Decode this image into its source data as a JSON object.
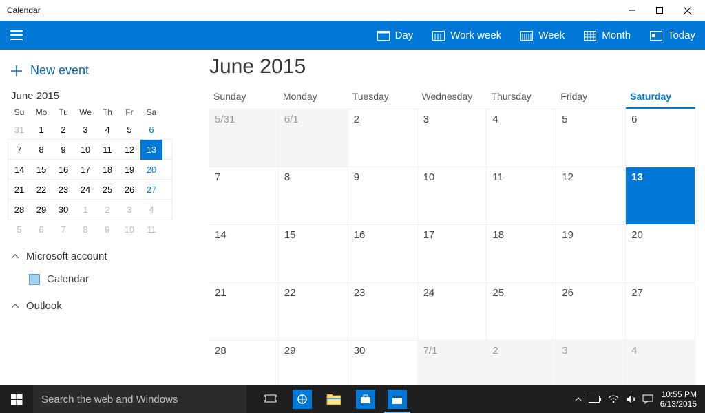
{
  "window": {
    "title": "Calendar"
  },
  "ribbon": {
    "views": {
      "day": "Day",
      "workweek": "Work week",
      "week": "Week",
      "month": "Month",
      "today": "Today"
    }
  },
  "sidebar": {
    "new_event": "New event",
    "mini": {
      "month_label": "June 2015",
      "dow": [
        "Su",
        "Mo",
        "Tu",
        "We",
        "Th",
        "Fr",
        "Sa"
      ],
      "rows": [
        [
          {
            "d": "31",
            "dim": true
          },
          {
            "d": "1"
          },
          {
            "d": "2"
          },
          {
            "d": "3"
          },
          {
            "d": "4"
          },
          {
            "d": "5"
          },
          {
            "d": "6",
            "sat": true
          }
        ],
        [
          {
            "d": "7"
          },
          {
            "d": "8"
          },
          {
            "d": "9"
          },
          {
            "d": "10"
          },
          {
            "d": "11"
          },
          {
            "d": "12"
          },
          {
            "d": "13",
            "sat": true,
            "today": true
          }
        ],
        [
          {
            "d": "14"
          },
          {
            "d": "15"
          },
          {
            "d": "16"
          },
          {
            "d": "17"
          },
          {
            "d": "18"
          },
          {
            "d": "19"
          },
          {
            "d": "20",
            "sat": true
          }
        ],
        [
          {
            "d": "21"
          },
          {
            "d": "22"
          },
          {
            "d": "23"
          },
          {
            "d": "24"
          },
          {
            "d": "25"
          },
          {
            "d": "26"
          },
          {
            "d": "27",
            "sat": true
          }
        ],
        [
          {
            "d": "28"
          },
          {
            "d": "29"
          },
          {
            "d": "30"
          },
          {
            "d": "1",
            "dim": true
          },
          {
            "d": "2",
            "dim": true
          },
          {
            "d": "3",
            "dim": true
          },
          {
            "d": "4",
            "dim": true
          }
        ],
        [
          {
            "d": "5",
            "dim": true
          },
          {
            "d": "6",
            "dim": true
          },
          {
            "d": "7",
            "dim": true
          },
          {
            "d": "8",
            "dim": true
          },
          {
            "d": "9",
            "dim": true
          },
          {
            "d": "10",
            "dim": true
          },
          {
            "d": "11",
            "dim": true
          }
        ]
      ]
    },
    "accounts": [
      {
        "name": "Microsoft account",
        "calendars": [
          {
            "name": "Calendar"
          }
        ]
      },
      {
        "name": "Outlook",
        "calendars": []
      }
    ]
  },
  "main": {
    "title": "June 2015",
    "dow": [
      "Sunday",
      "Monday",
      "Tuesday",
      "Wednesday",
      "Thursday",
      "Friday",
      "Saturday"
    ],
    "cells": [
      {
        "d": "5/31",
        "other": true
      },
      {
        "d": "6/1",
        "other": true
      },
      {
        "d": "2"
      },
      {
        "d": "3"
      },
      {
        "d": "4"
      },
      {
        "d": "5"
      },
      {
        "d": "6"
      },
      {
        "d": "7"
      },
      {
        "d": "8"
      },
      {
        "d": "9"
      },
      {
        "d": "10"
      },
      {
        "d": "11"
      },
      {
        "d": "12"
      },
      {
        "d": "13",
        "today": true
      },
      {
        "d": "14"
      },
      {
        "d": "15"
      },
      {
        "d": "16"
      },
      {
        "d": "17"
      },
      {
        "d": "18"
      },
      {
        "d": "19"
      },
      {
        "d": "20"
      },
      {
        "d": "21"
      },
      {
        "d": "22"
      },
      {
        "d": "23"
      },
      {
        "d": "24"
      },
      {
        "d": "25"
      },
      {
        "d": "26"
      },
      {
        "d": "27"
      },
      {
        "d": "28"
      },
      {
        "d": "29"
      },
      {
        "d": "30"
      },
      {
        "d": "7/1",
        "other": true
      },
      {
        "d": "2",
        "other": true
      },
      {
        "d": "3",
        "other": true
      },
      {
        "d": "4",
        "other": true
      }
    ]
  },
  "taskbar": {
    "search_placeholder": "Search the web and Windows",
    "clock_time": "10:55 PM",
    "clock_date": "6/13/2015"
  }
}
